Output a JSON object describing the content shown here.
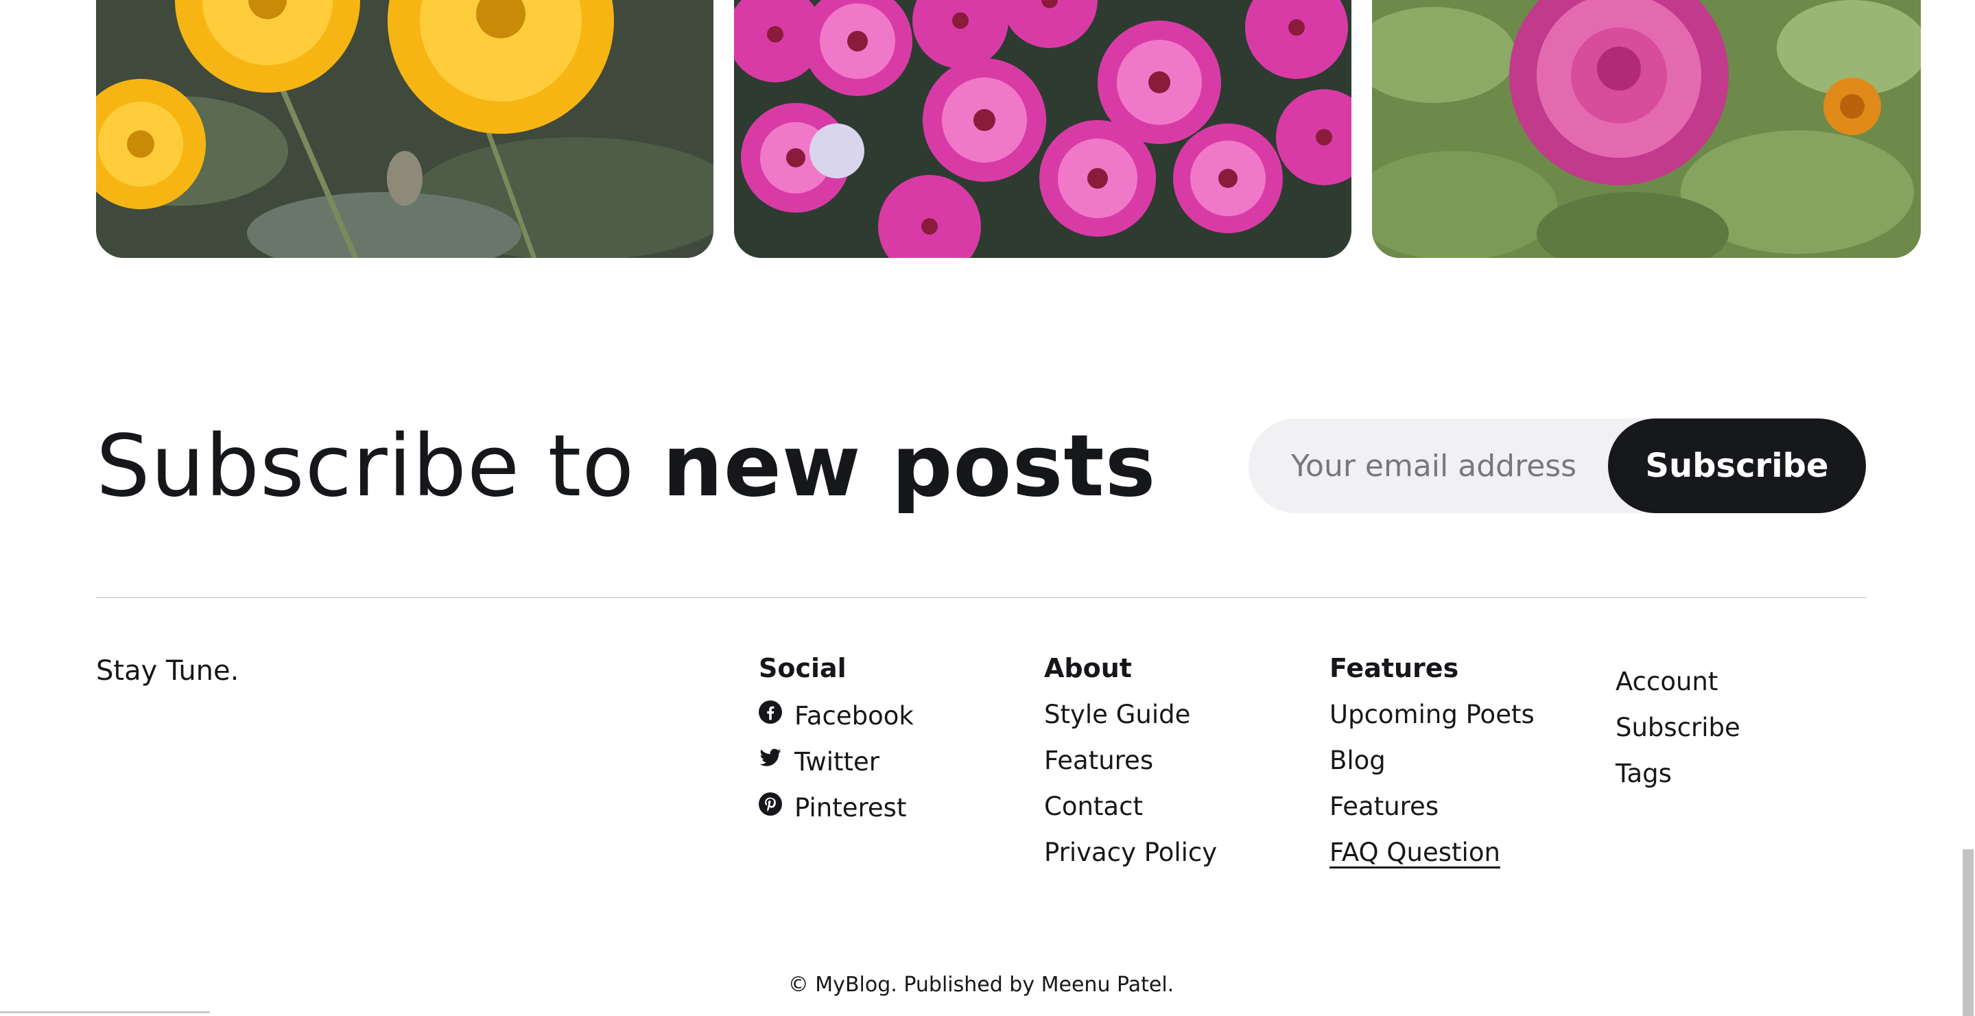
{
  "cards": [
    {
      "alt": "yellow flowers image"
    },
    {
      "alt": "pink flowers image"
    },
    {
      "alt": "pink dahlia image"
    }
  ],
  "subscribe": {
    "title_light": "Subscribe to ",
    "title_bold": "new posts",
    "email_placeholder": "Your email address",
    "button_label": "Subscribe"
  },
  "footer": {
    "tagline": "Stay Tune.",
    "social": {
      "heading": "Social",
      "items": [
        {
          "label": "Facebook",
          "icon": "facebook-icon"
        },
        {
          "label": "Twitter",
          "icon": "twitter-icon"
        },
        {
          "label": "Pinterest",
          "icon": "pinterest-icon"
        }
      ]
    },
    "about": {
      "heading": "About",
      "items": [
        "Style Guide",
        "Features",
        "Contact",
        "Privacy Policy"
      ]
    },
    "features": {
      "heading": "Features",
      "items": [
        "Upcoming Poets",
        "Blog",
        "Features",
        "FAQ Question"
      ]
    },
    "extra": {
      "items": [
        "Account",
        "Subscribe",
        "Tags"
      ]
    },
    "copyright": "© MyBlog. Published by Meenu Patel."
  },
  "colors": {
    "text": "#15171a",
    "button_bg": "#17181c",
    "input_bg": "#f1f0f3",
    "divider": "#d8d9db"
  }
}
